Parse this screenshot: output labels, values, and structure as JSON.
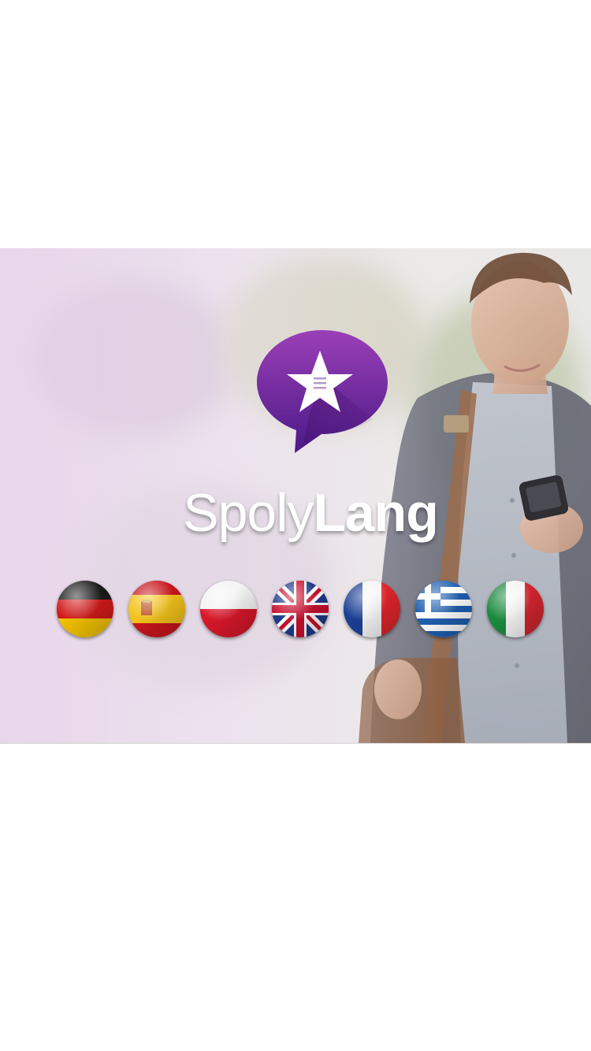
{
  "brand": {
    "name_light": "Spoly",
    "name_bold": "Lang"
  },
  "colors": {
    "logo_purple_top": "#9b3fb8",
    "logo_purple_bottom": "#4b1a86",
    "background_tint": "#e7d6e9",
    "text": "#ffffff"
  },
  "logo": {
    "icon": "star-speech-bubble-icon"
  },
  "flags": [
    {
      "icon": "germany-flag-icon",
      "country": "germany"
    },
    {
      "icon": "spain-flag-icon",
      "country": "spain"
    },
    {
      "icon": "poland-flag-icon",
      "country": "poland"
    },
    {
      "icon": "united-kingdom-flag-icon",
      "country": "united-kingdom"
    },
    {
      "icon": "france-flag-icon",
      "country": "france"
    },
    {
      "icon": "greece-flag-icon",
      "country": "greece"
    },
    {
      "icon": "italy-flag-icon",
      "country": "italy"
    }
  ]
}
